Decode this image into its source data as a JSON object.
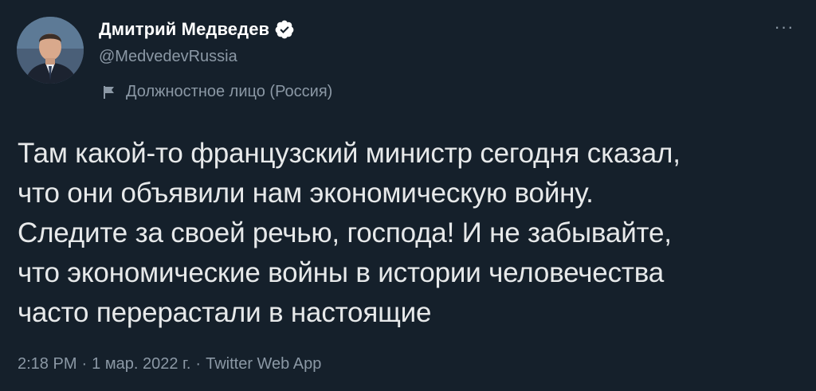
{
  "author": {
    "display_name": "Дмитрий Медведев",
    "handle": "@MedvedevRussia",
    "label": "Должностное лицо (Россия)"
  },
  "icons": {
    "verified": "verified-badge-icon",
    "label": "flag-icon",
    "more": "more-icon",
    "more_glyph": "···"
  },
  "tweet": {
    "lines": [
      "Там какой-то французский министр сегодня сказал,",
      "что они объявили нам экономическую войну.",
      "Следите за своей речью, господа! И не забывайте,",
      "что экономические войны в истории человечества",
      "часто перерастали в настоящие"
    ]
  },
  "meta": {
    "time": "2:18 PM",
    "sep1": "·",
    "date": "1 мар. 2022 г.",
    "sep2": "·",
    "source": "Twitter Web App"
  },
  "colors": {
    "background": "#15202b",
    "text": "#e7e9ea",
    "secondary": "#8b98a5",
    "verified_badge": "#ffffff"
  }
}
